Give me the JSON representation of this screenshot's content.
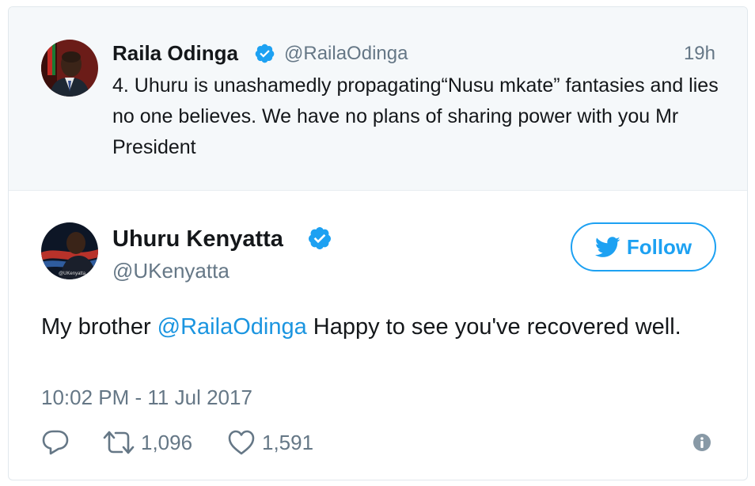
{
  "quoted_tweet": {
    "author_name": "Raila Odinga",
    "verified": true,
    "handle": "@RailaOdinga",
    "time": "19h",
    "text": "4. Uhuru is unashamedly propagating“Nusu mkate” fantasies and lies no one believes. We have no plans of sharing power with you Mr President"
  },
  "main_tweet": {
    "author_name": "Uhuru Kenyatta",
    "verified": true,
    "handle": "@UKenyatta",
    "follow_label": "Follow",
    "text_before": "My brother ",
    "mention": "@RailaOdinga",
    "text_after": " Happy to see you've recovered well.",
    "timestamp": "10:02 PM - 11 Jul 2017",
    "avatar_caption": "@UKenyatta"
  },
  "actions": {
    "reply_icon": "reply-icon",
    "retweet_icon": "retweet-icon",
    "retweet_count": "1,096",
    "like_icon": "heart-icon",
    "like_count": "1,591",
    "info_icon": "info-icon"
  },
  "colors": {
    "accent": "#1da1f2",
    "mention": "#1b95e0",
    "muted": "#657786",
    "text": "#14171a",
    "quoted_bg": "#f5f8fa"
  }
}
